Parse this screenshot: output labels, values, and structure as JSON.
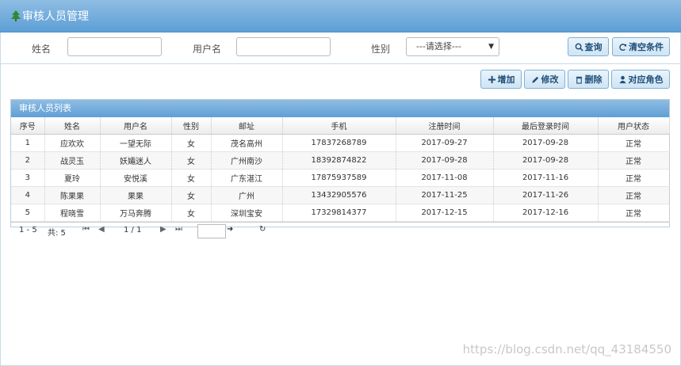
{
  "header": {
    "title": "审核人员管理"
  },
  "search": {
    "name_label": "姓名",
    "username_label": "用户名",
    "gender_label": "性别",
    "name_value": "",
    "username_value": "",
    "gender_selected": "---请选择---",
    "query_label": "查询",
    "clear_label": "清空条件"
  },
  "toolbar": {
    "add_label": "增加",
    "edit_label": "修改",
    "delete_label": "删除",
    "role_label": "对应角色"
  },
  "grid": {
    "title": "审核人员列表",
    "columns": [
      "序号",
      "姓名",
      "用户名",
      "性别",
      "邮址",
      "手机",
      "注册时间",
      "最后登录时间",
      "用户状态"
    ],
    "rows": [
      [
        "1",
        "应欢欢",
        "一望无际",
        "女",
        "茂名高州",
        "17837268789",
        "2017-09-27",
        "2017-09-28",
        "正常"
      ],
      [
        "2",
        "战灵玉",
        "妖孀迷人",
        "女",
        "广州南沙",
        "18392874822",
        "2017-09-28",
        "2017-09-28",
        "正常"
      ],
      [
        "3",
        "夏玲",
        "安悦溪",
        "女",
        "广东湛江",
        "17875937589",
        "2017-11-08",
        "2017-11-16",
        "正常"
      ],
      [
        "4",
        "陈果果",
        "果果",
        "女",
        "广州",
        "13432905576",
        "2017-11-25",
        "2017-11-26",
        "正常"
      ],
      [
        "5",
        "程晓雪",
        "万马奔腾",
        "女",
        "深圳宝安",
        "17329814377",
        "2017-12-15",
        "2017-12-16",
        "正常"
      ]
    ]
  },
  "pager": {
    "range": "1 - 5",
    "total": "共: 5",
    "page_info": "1 / 1",
    "page_input": ""
  },
  "watermark": "https://blog.csdn.net/qq_43184550"
}
